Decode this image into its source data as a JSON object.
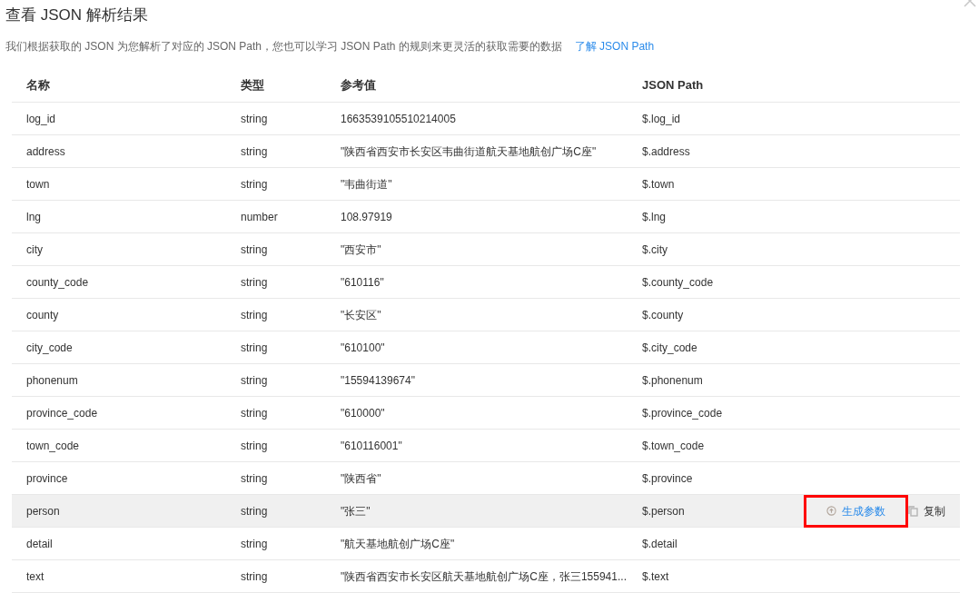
{
  "title": "查看 JSON 解析结果",
  "description": "我们根据获取的 JSON 为您解析了对应的 JSON Path，您也可以学习 JSON Path 的规则来更灵活的获取需要的数据",
  "learn_link": "了解 JSON Path",
  "table": {
    "columns": [
      "名称",
      "类型",
      "参考值",
      "JSON Path"
    ],
    "rows": [
      {
        "name": "log_id",
        "type": "string",
        "value": "1663539105510214005",
        "path": "$.log_id",
        "selected": false
      },
      {
        "name": "address",
        "type": "string",
        "value": "\"陕西省西安市长安区韦曲街道航天基地航创广场C座\"",
        "path": "$.address",
        "selected": false
      },
      {
        "name": "town",
        "type": "string",
        "value": "\"韦曲街道\"",
        "path": "$.town",
        "selected": false
      },
      {
        "name": "lng",
        "type": "number",
        "value": "108.97919",
        "path": "$.lng",
        "selected": false
      },
      {
        "name": "city",
        "type": "string",
        "value": "\"西安市\"",
        "path": "$.city",
        "selected": false
      },
      {
        "name": "county_code",
        "type": "string",
        "value": "\"610116\"",
        "path": "$.county_code",
        "selected": false
      },
      {
        "name": "county",
        "type": "string",
        "value": "\"长安区\"",
        "path": "$.county",
        "selected": false
      },
      {
        "name": "city_code",
        "type": "string",
        "value": "\"610100\"",
        "path": "$.city_code",
        "selected": false
      },
      {
        "name": "phonenum",
        "type": "string",
        "value": "\"15594139674\"",
        "path": "$.phonenum",
        "selected": false
      },
      {
        "name": "province_code",
        "type": "string",
        "value": "\"610000\"",
        "path": "$.province_code",
        "selected": false
      },
      {
        "name": "town_code",
        "type": "string",
        "value": "\"610116001\"",
        "path": "$.town_code",
        "selected": false
      },
      {
        "name": "province",
        "type": "string",
        "value": "\"陕西省\"",
        "path": "$.province",
        "selected": false
      },
      {
        "name": "person",
        "type": "string",
        "value": "\"张三\"",
        "path": "$.person",
        "selected": true,
        "actions": [
          {
            "kind": "generate",
            "label": "生成参数",
            "highlighted": true
          },
          {
            "kind": "copy",
            "label": "复制"
          }
        ]
      },
      {
        "name": "detail",
        "type": "string",
        "value": "\"航天基地航创广场C座\"",
        "path": "$.detail",
        "selected": false
      },
      {
        "name": "text",
        "type": "string",
        "value": "\"陕西省西安市长安区航天基地航创广场C座，张三155941...",
        "path": "$.text",
        "selected": false
      }
    ]
  }
}
